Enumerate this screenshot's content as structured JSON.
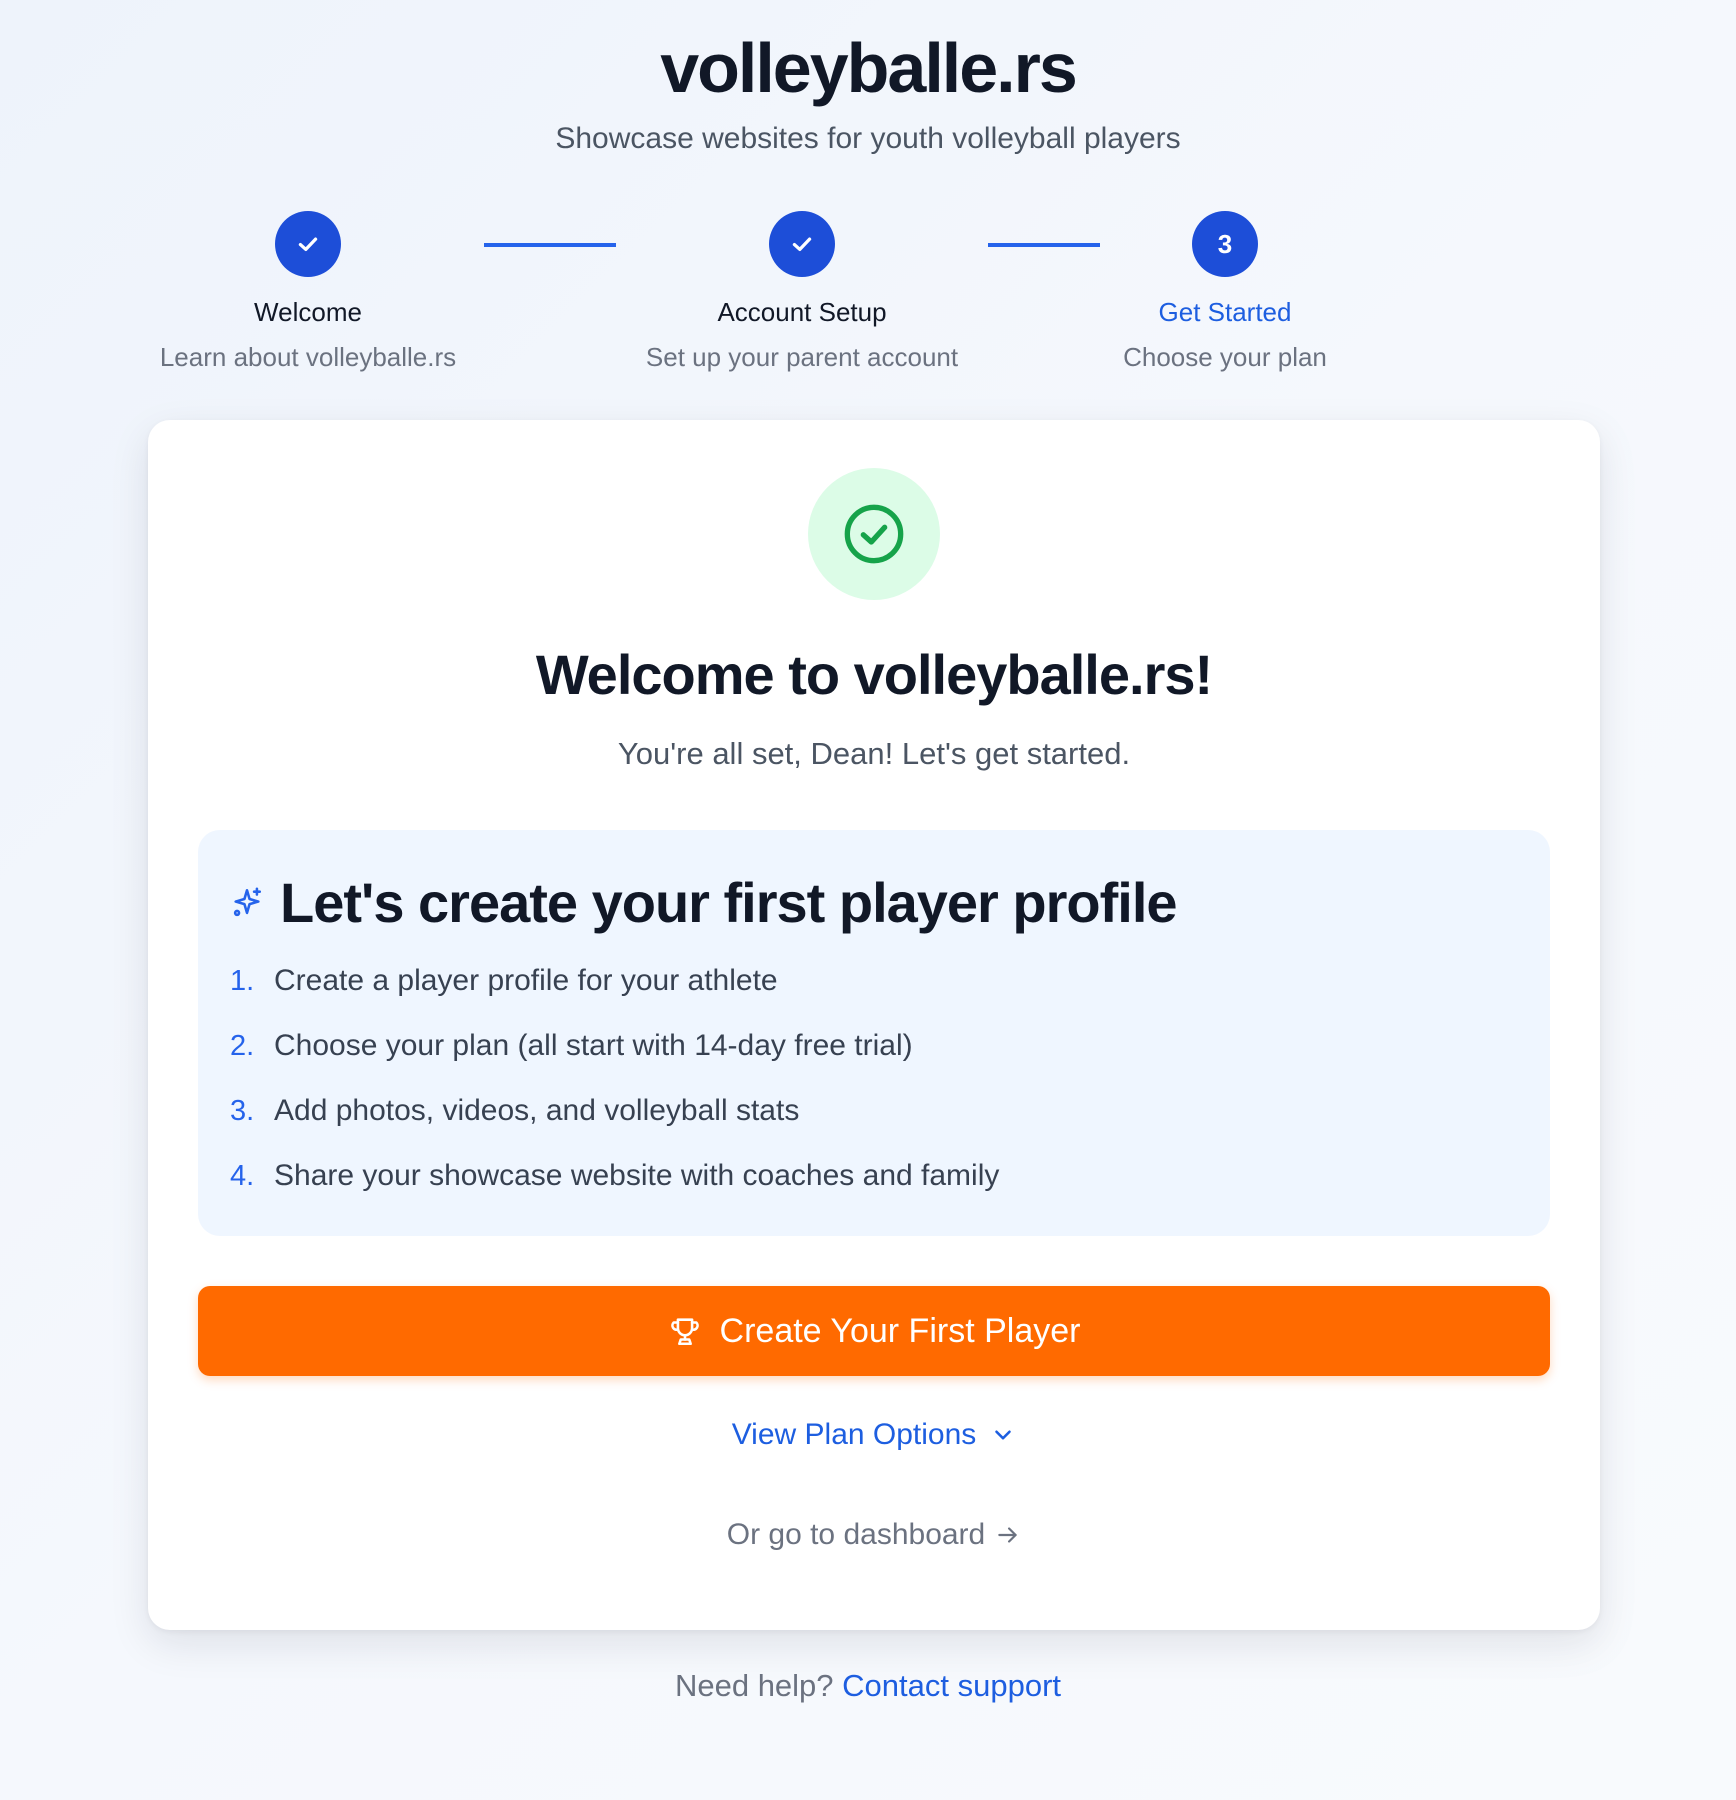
{
  "header": {
    "brand": "volleyballe.rs",
    "tagline": "Showcase websites for youth volleyball players"
  },
  "stepper": {
    "steps": [
      {
        "marker": "",
        "title": "Welcome",
        "subtitle": "Learn about volleyballe.rs",
        "status": "complete"
      },
      {
        "marker": "",
        "title": "Account Setup",
        "subtitle": "Set up your parent account",
        "status": "complete"
      },
      {
        "marker": "3",
        "title": "Get Started",
        "subtitle": "Choose your plan",
        "status": "active"
      }
    ]
  },
  "card": {
    "title": "Welcome to volleyballe.rs!",
    "subtitle": "You're all set, Dean! Let's get started.",
    "info": {
      "heading": "Let's create your first player profile",
      "items": [
        {
          "num": "1.",
          "text": "Create a player profile for your athlete"
        },
        {
          "num": "2.",
          "text": "Choose your plan (all start with 14-day free trial)"
        },
        {
          "num": "3.",
          "text": "Add photos, videos, and volleyball stats"
        },
        {
          "num": "4.",
          "text": "Share your showcase website with coaches and family"
        }
      ]
    },
    "cta_label": "Create Your First Player",
    "plan_options_label": "View Plan Options",
    "dashboard_label": "Or go to dashboard"
  },
  "footer": {
    "help_text": "Need help?",
    "support_link": "Contact support"
  },
  "colors": {
    "primary": "#1d4ed8",
    "cta": "#ff6a00",
    "success": "#16a34a",
    "success_bg": "#dcfce7",
    "info_bg": "#eff6ff"
  },
  "icons": {
    "completed_step": "check-icon",
    "success": "check-circle-icon",
    "heading": "sparkles-icon",
    "cta": "trophy-icon",
    "plan_options": "chevron-down-icon",
    "dashboard": "arrow-right-icon"
  }
}
